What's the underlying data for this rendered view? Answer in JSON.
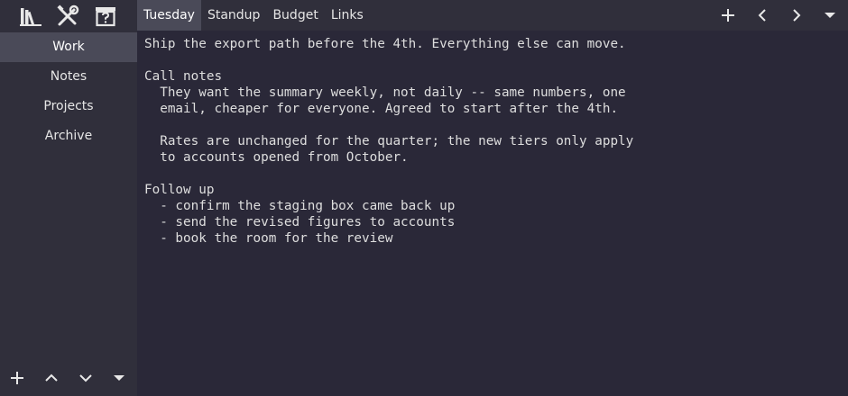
{
  "sidebar": {
    "toolbar": [
      {
        "icon": "library-icon"
      },
      {
        "icon": "tools-icon"
      },
      {
        "icon": "help-box-icon"
      }
    ],
    "items": [
      {
        "label": "Work",
        "active": true
      },
      {
        "label": "Notes",
        "active": false
      },
      {
        "label": "Projects",
        "active": false
      },
      {
        "label": "Archive",
        "active": false
      }
    ],
    "footer": [
      {
        "icon": "plus-icon"
      },
      {
        "icon": "chevron-up-icon"
      },
      {
        "icon": "chevron-down-icon"
      },
      {
        "icon": "dropdown-triangle-icon"
      }
    ]
  },
  "tabs": [
    {
      "label": "Tuesday",
      "active": true
    },
    {
      "label": "Standup",
      "active": false
    },
    {
      "label": "Budget",
      "active": false
    },
    {
      "label": "Links",
      "active": false
    }
  ],
  "topbar_buttons": [
    {
      "icon": "plus-icon"
    },
    {
      "icon": "chevron-left-icon"
    },
    {
      "icon": "chevron-right-icon"
    },
    {
      "icon": "dropdown-triangle-icon"
    }
  ],
  "editor": {
    "text": "Ship the export path before the 4th. Everything else can move.\n\nCall notes\n  They want the summary weekly, not daily -- same numbers, one\n  email, cheaper for everyone. Agreed to start after the 4th.\n\n  Rates are unchanged for the quarter; the new tiers only apply\n  to accounts opened from October.\n\nFollow up\n  - confirm the staging box came back up\n  - send the revised figures to accounts\n  - book the room for the review"
  },
  "colors": {
    "sidebar_bg": "#302f3b",
    "editor_bg": "#2a2838",
    "active_bg": "#4a4a58",
    "text": "#dedede"
  }
}
